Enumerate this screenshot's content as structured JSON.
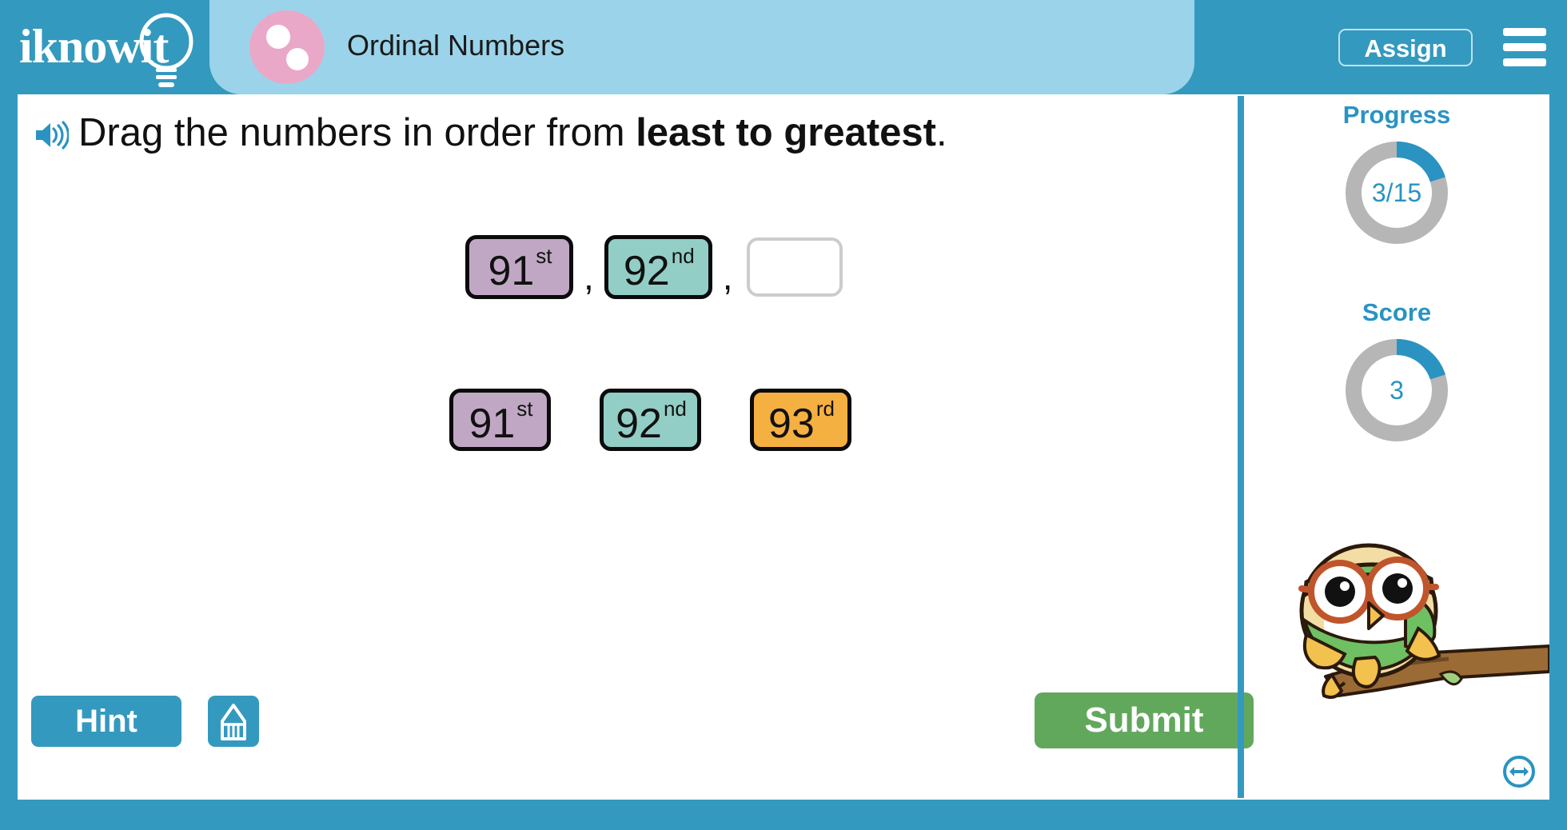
{
  "header": {
    "logo_text": "iknowit",
    "logo_icon": "lightbulb-icon",
    "subject_icon": "pink-circle-dots-icon",
    "title": "Ordinal Numbers",
    "assign_label": "Assign",
    "menu_icon": "hamburger-menu-icon"
  },
  "question": {
    "speaker_icon": "speaker-audio-icon",
    "prefix": "Drag the numbers in order from ",
    "emphasis": "least to greatest",
    "suffix": "."
  },
  "answer_row": {
    "tiles": [
      {
        "number": "91",
        "suffix": "st",
        "color": "#c0a8c4"
      },
      {
        "number": "92",
        "suffix": "nd",
        "color": "#93cec6"
      }
    ],
    "separator": ",",
    "empty_slot_label": ""
  },
  "source_row": {
    "tiles": [
      {
        "number": "91",
        "suffix": "st",
        "color": "#c0a8c4"
      },
      {
        "number": "92",
        "suffix": "nd",
        "color": "#93cec6"
      },
      {
        "number": "93",
        "suffix": "rd",
        "color": "#f5b042"
      }
    ]
  },
  "actions": {
    "hint_label": "Hint",
    "scratchpad_icon": "pencil-scratchpad-icon",
    "submit_label": "Submit"
  },
  "sidebar": {
    "progress": {
      "title": "Progress",
      "value_label": "3/15",
      "completed": 3,
      "total": 15,
      "percent": 20
    },
    "score": {
      "title": "Score",
      "value_label": "3",
      "percent": 20
    },
    "mascot_icon": "owl-mascot-icon",
    "resize_icon": "resize-horizontal-icon"
  },
  "colors": {
    "frame_blue": "#3499bf",
    "title_pill_blue": "#9bd4ea",
    "accent_blue": "#2a93c2",
    "donut_track_gray": "#b6b6b6",
    "submit_green": "#62a85c",
    "subject_pink": "#eaa8c8"
  }
}
